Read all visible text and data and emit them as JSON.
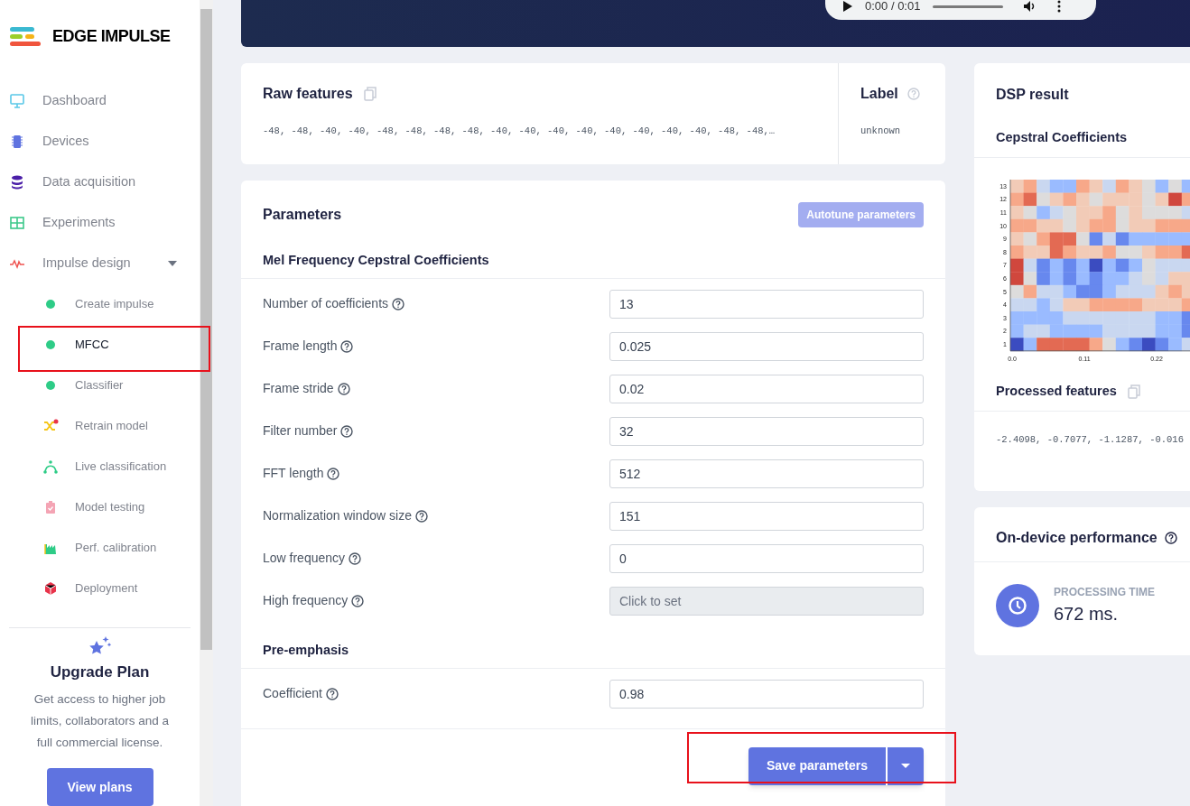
{
  "brand": {
    "name": "EDGE IMPULSE"
  },
  "sidebar": {
    "items": [
      {
        "label": "Dashboard",
        "kind": "main",
        "selected": false
      },
      {
        "label": "Devices",
        "kind": "main",
        "selected": false
      },
      {
        "label": "Data acquisition",
        "kind": "main",
        "selected": false
      },
      {
        "label": "Experiments",
        "kind": "main",
        "selected": false
      },
      {
        "label": "Impulse design",
        "kind": "main",
        "selected": false,
        "expanded": true,
        "children": [
          {
            "label": "Create impulse",
            "kind": "sub",
            "selected": false
          },
          {
            "label": "MFCC",
            "kind": "sub",
            "selected": true,
            "highlighted": true
          },
          {
            "label": "Classifier",
            "kind": "sub",
            "selected": false
          }
        ]
      },
      {
        "label": "Retrain model",
        "kind": "sub",
        "selected": false
      },
      {
        "label": "Live classification",
        "kind": "sub",
        "selected": false
      },
      {
        "label": "Model testing",
        "kind": "sub",
        "selected": false
      },
      {
        "label": "Perf. calibration",
        "kind": "sub",
        "selected": false
      },
      {
        "label": "Deployment",
        "kind": "sub",
        "selected": false
      }
    ]
  },
  "upgrade": {
    "title": "Upgrade Plan",
    "text": "Get access to higher job limits, collaborators and a full commercial license.",
    "button": "View plans"
  },
  "player": {
    "time": "0:00 / 0:01"
  },
  "raw_features": {
    "title": "Raw features",
    "values": "-48, -48, -40, -40, -48, -48, -48, -48, -40, -40, -40, -40, -40, -40, -40, -40, -48, -48,…",
    "label_title": "Label",
    "label_value": "unknown"
  },
  "parameters": {
    "title": "Parameters",
    "autotune_button": "Autotune parameters",
    "sections": [
      {
        "title": "Mel Frequency Cepstral Coefficients",
        "fields": [
          {
            "label": "Number of coefficients",
            "value": "13"
          },
          {
            "label": "Frame length",
            "value": "0.025"
          },
          {
            "label": "Frame stride",
            "value": "0.02"
          },
          {
            "label": "Filter number",
            "value": "32"
          },
          {
            "label": "FFT length",
            "value": "512"
          },
          {
            "label": "Normalization window size",
            "value": "151"
          },
          {
            "label": "Low frequency",
            "value": "0"
          },
          {
            "label": "High frequency",
            "placeholder": "Click to set",
            "disabled": true
          }
        ]
      },
      {
        "title": "Pre-emphasis",
        "fields": [
          {
            "label": "Coefficient",
            "value": "0.98"
          }
        ]
      }
    ],
    "save_button": "Save parameters",
    "save_highlighted": true
  },
  "dsp_result": {
    "title": "DSP result",
    "chart_title": "Cepstral Coefficients",
    "y_ticks": [
      "13",
      "12",
      "11",
      "10",
      "9",
      "8",
      "7",
      "6",
      "5",
      "4",
      "3",
      "2",
      "1"
    ],
    "x_ticks": [
      "0.0",
      "0.11",
      "0.22"
    ],
    "processed_title": "Processed features",
    "processed_values": "-2.4098, -0.7077, -1.1287, -0.016"
  },
  "performance": {
    "title": "On-device performance",
    "metric_label": "PROCESSING TIME",
    "metric_value": "672 ms."
  }
}
